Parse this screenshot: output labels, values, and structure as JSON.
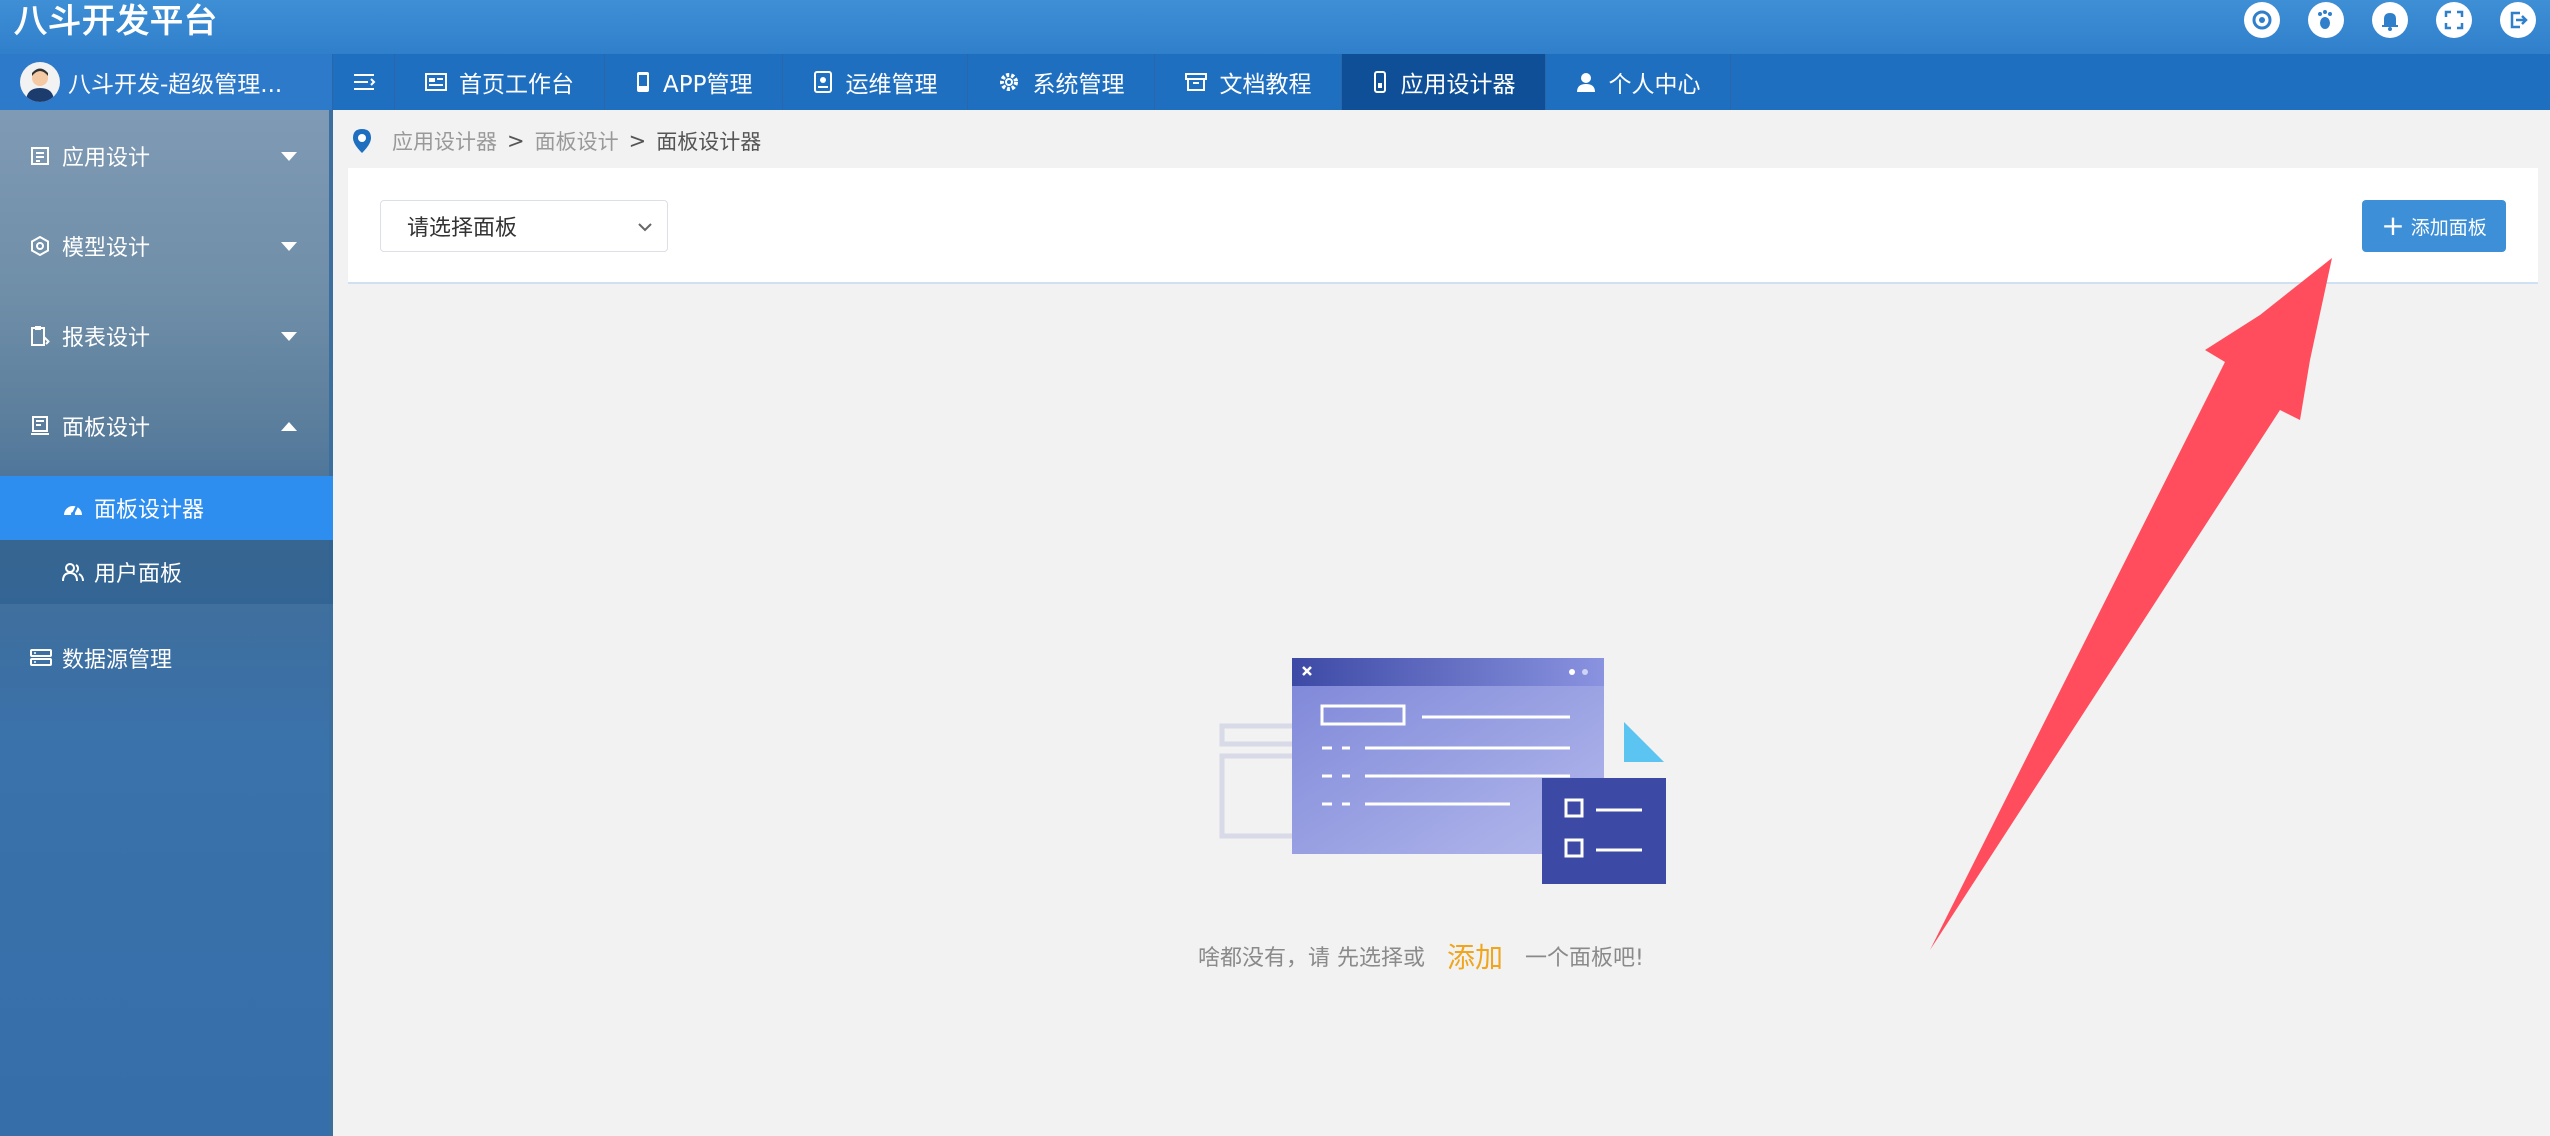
{
  "app": {
    "title": "八斗开发平台"
  },
  "top_icons": [
    "refresh-icon",
    "footprint-icon",
    "bell-icon",
    "fullscreen-icon",
    "logout-icon"
  ],
  "user": {
    "name": "八斗开发-超级管理..."
  },
  "nav": {
    "items": [
      {
        "label": "首页工作台",
        "icon": "dashboard-icon"
      },
      {
        "label": "APP管理",
        "icon": "phone-icon"
      },
      {
        "label": "运维管理",
        "icon": "ops-icon"
      },
      {
        "label": "系统管理",
        "icon": "gear-icon"
      },
      {
        "label": "文档教程",
        "icon": "archive-icon"
      },
      {
        "label": "应用设计器",
        "icon": "designer-icon",
        "active": true
      },
      {
        "label": "个人中心",
        "icon": "user-icon"
      }
    ]
  },
  "sidebar": {
    "items": [
      {
        "label": "应用设计",
        "icon": "app-design-icon",
        "expanded": false
      },
      {
        "label": "模型设计",
        "icon": "model-icon",
        "expanded": false
      },
      {
        "label": "报表设计",
        "icon": "report-icon",
        "expanded": false
      },
      {
        "label": "面板设计",
        "icon": "panel-icon",
        "expanded": true
      },
      {
        "label": "数据源管理",
        "icon": "database-icon"
      }
    ],
    "subitems": [
      {
        "label": "面板设计器",
        "icon": "gauge-icon",
        "active": true
      },
      {
        "label": "用户面板",
        "icon": "users-icon"
      }
    ]
  },
  "breadcrumb": {
    "items": [
      "应用设计器",
      "面板设计",
      "面板设计器"
    ],
    "separator": ">"
  },
  "panel": {
    "select_placeholder": "请选择面板",
    "add_button": "添加面板"
  },
  "empty_state": {
    "text_before": "啥都没有，请 先选择或",
    "action": "添加",
    "text_after": "一个面板吧!"
  },
  "colors": {
    "header": "#2f7fcb",
    "nav": "#1f6fc1",
    "nav_active": "#0f4f97",
    "sidebar_active": "#2e8ef0",
    "button": "#3d8fd8",
    "highlight": "#f0a51c",
    "arrow": "#ff4d5e"
  }
}
